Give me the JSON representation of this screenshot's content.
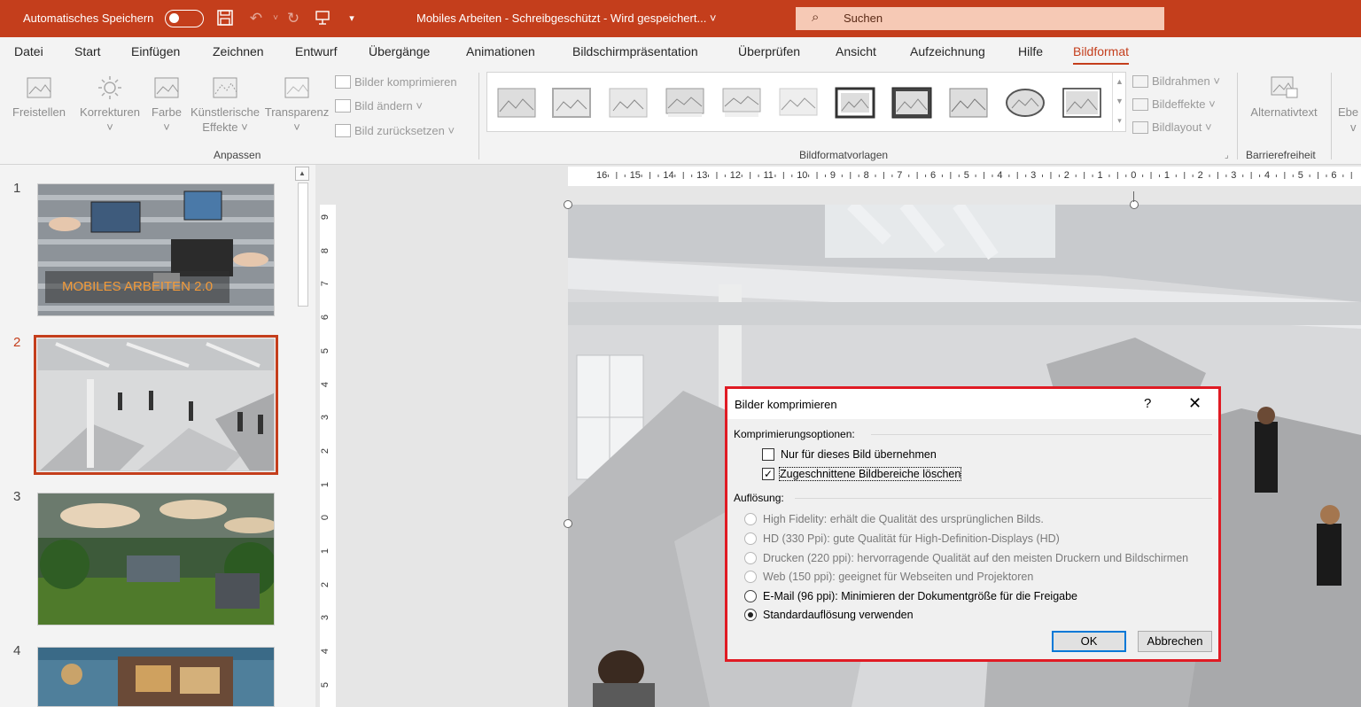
{
  "titlebar": {
    "autosave_label": "Automatisches Speichern",
    "document_title": "Mobiles Arbeiten - Schreibgeschützt - Wird gespeichert... ˅",
    "search_placeholder": "Suchen"
  },
  "menu": {
    "tabs": [
      "Datei",
      "Start",
      "Einfügen",
      "Zeichnen",
      "Entwurf",
      "Übergänge",
      "Animationen",
      "Bildschirmpräsentation",
      "Überprüfen",
      "Ansicht",
      "Aufzeichnung",
      "Hilfe",
      "Bildformat"
    ],
    "active_tab": "Bildformat"
  },
  "ribbon": {
    "freistellen": "Freistellen",
    "korrekturen": "Korrekturen",
    "farbe": "Farbe",
    "kuenstlerische_1": "Künstlerische",
    "kuenstlerische_2": "Effekte ˅",
    "transparenz": "Transparenz",
    "bilder_komprimieren": "Bilder komprimieren",
    "bild_aendern": "Bild ändern ˅",
    "bild_zuruecksetzen": "Bild zurücksetzen ˅",
    "group_anpassen": "Anpassen",
    "group_bildformatvorlagen": "Bildformatvorlagen",
    "bildrahmen": "Bildrahmen ˅",
    "bildeffekte": "Bildeffekte ˅",
    "bildlayout": "Bildlayout ˅",
    "alternativtext": "Alternativtext",
    "group_barrierefreiheit": "Barrierefreiheit",
    "ebene_partial_1": "Ebe",
    "ebene_partial_2": "v"
  },
  "slides": {
    "numbers": [
      "1",
      "2",
      "3",
      "4"
    ],
    "slide1_title": "MOBILES ARBEITEN 2.0"
  },
  "ruler": {
    "horizontal": [
      "16",
      "15",
      "14",
      "13",
      "12",
      "11",
      "10",
      "9",
      "8",
      "7",
      "6",
      "5",
      "4",
      "3",
      "2",
      "1",
      "0",
      "1",
      "2",
      "3",
      "4",
      "5",
      "6"
    ],
    "vertical": [
      "9",
      "8",
      "7",
      "6",
      "5",
      "4",
      "3",
      "2",
      "1",
      "0",
      "1",
      "2",
      "3",
      "4",
      "5"
    ]
  },
  "dialog": {
    "title": "Bilder komprimieren",
    "help": "?",
    "close": "✕",
    "section_compression": "Komprimierungsoptionen:",
    "opt_only_this": "Nur für dieses Bild übernehmen",
    "opt_only_this_checked": false,
    "opt_delete_cropped": "Zugeschnittene Bildbereiche löschen",
    "opt_delete_cropped_checked": true,
    "section_resolution": "Auflösung:",
    "res_hifi": "High Fidelity: erhält die Qualität des ursprünglichen Bilds.",
    "res_hd": "HD (330 Ppi): gute Qualität für High-Definition-Displays (HD)",
    "res_print": "Drucken (220 ppi): hervorragende Qualität auf den meisten Druckern und Bildschirmen",
    "res_web": "Web (150 ppi): geeignet für Webseiten und Projektoren",
    "res_email": "E-Mail (96 ppi): Minimieren der Dokumentgröße für die Freigabe",
    "res_default": "Standardauflösung verwenden",
    "selected_resolution": "Standardauflösung verwenden",
    "ok": "OK",
    "cancel": "Abbrechen"
  },
  "colors": {
    "accent": "#c43e1c",
    "dialog_highlight": "#e01b24",
    "default_button_border": "#0078d7"
  }
}
